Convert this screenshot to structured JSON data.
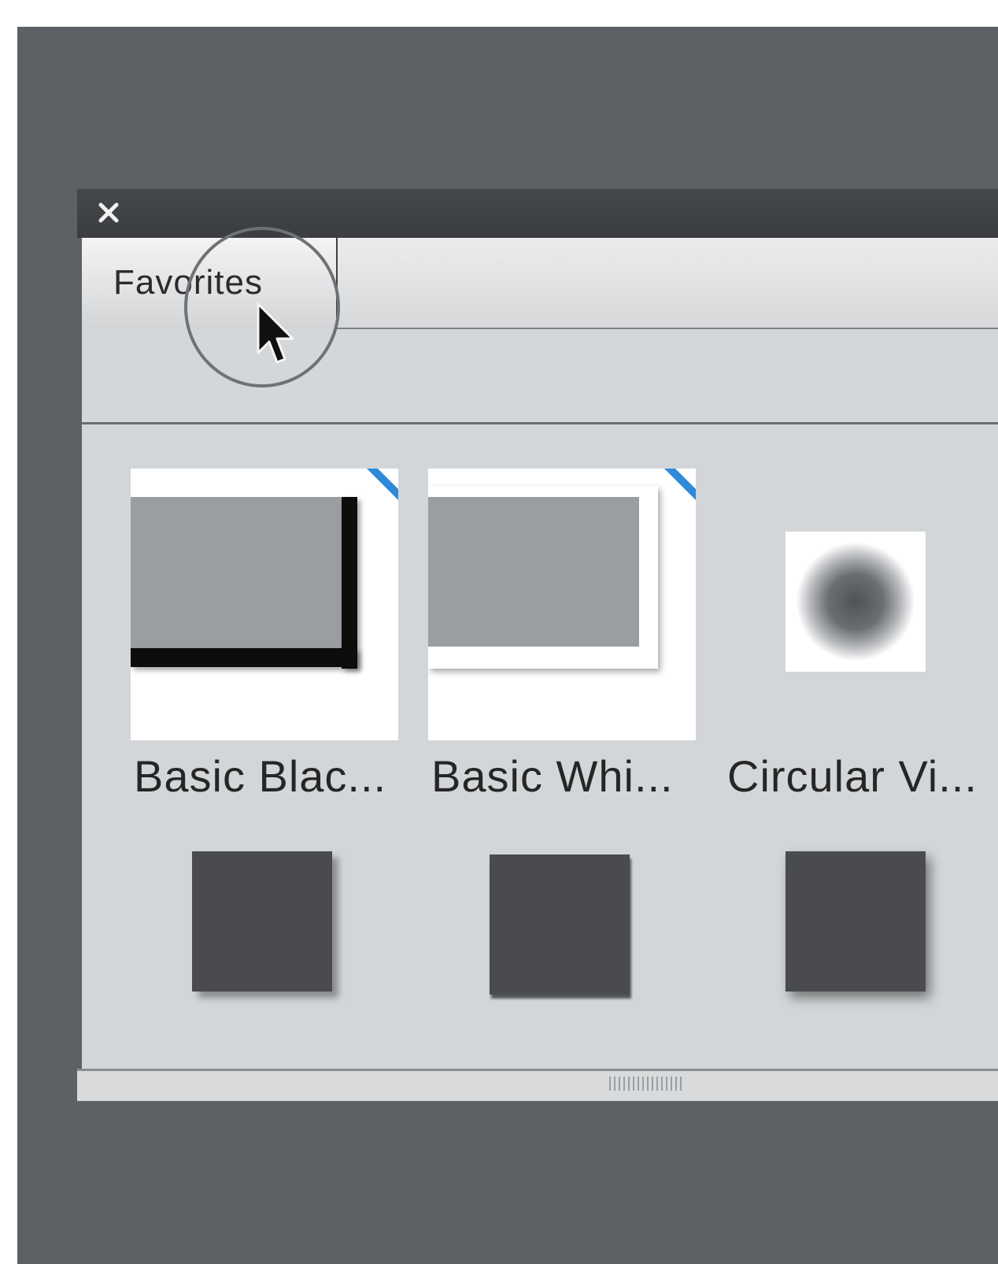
{
  "panel": {
    "close_icon": "close-icon",
    "tabs": [
      {
        "label": "Favorites"
      }
    ]
  },
  "items": [
    {
      "label": "Basic Blac...",
      "type": "black-border-thumbnail"
    },
    {
      "label": "Basic Whi...",
      "type": "white-border-thumbnail"
    },
    {
      "label": "Circular Vi...",
      "type": "circular-vignette-thumbnail"
    }
  ],
  "second_row_icons": [
    "drop-shadow-square-icon",
    "drop-shadow-square-icon",
    "drop-shadow-square-icon"
  ],
  "colors": {
    "app_background": "#5d6064",
    "panel_background": "#d3d6d8",
    "titlebar": "#3f4245",
    "corner_accent": "#2e8ad8",
    "thumbnail_dark": "#4a4b4e"
  }
}
